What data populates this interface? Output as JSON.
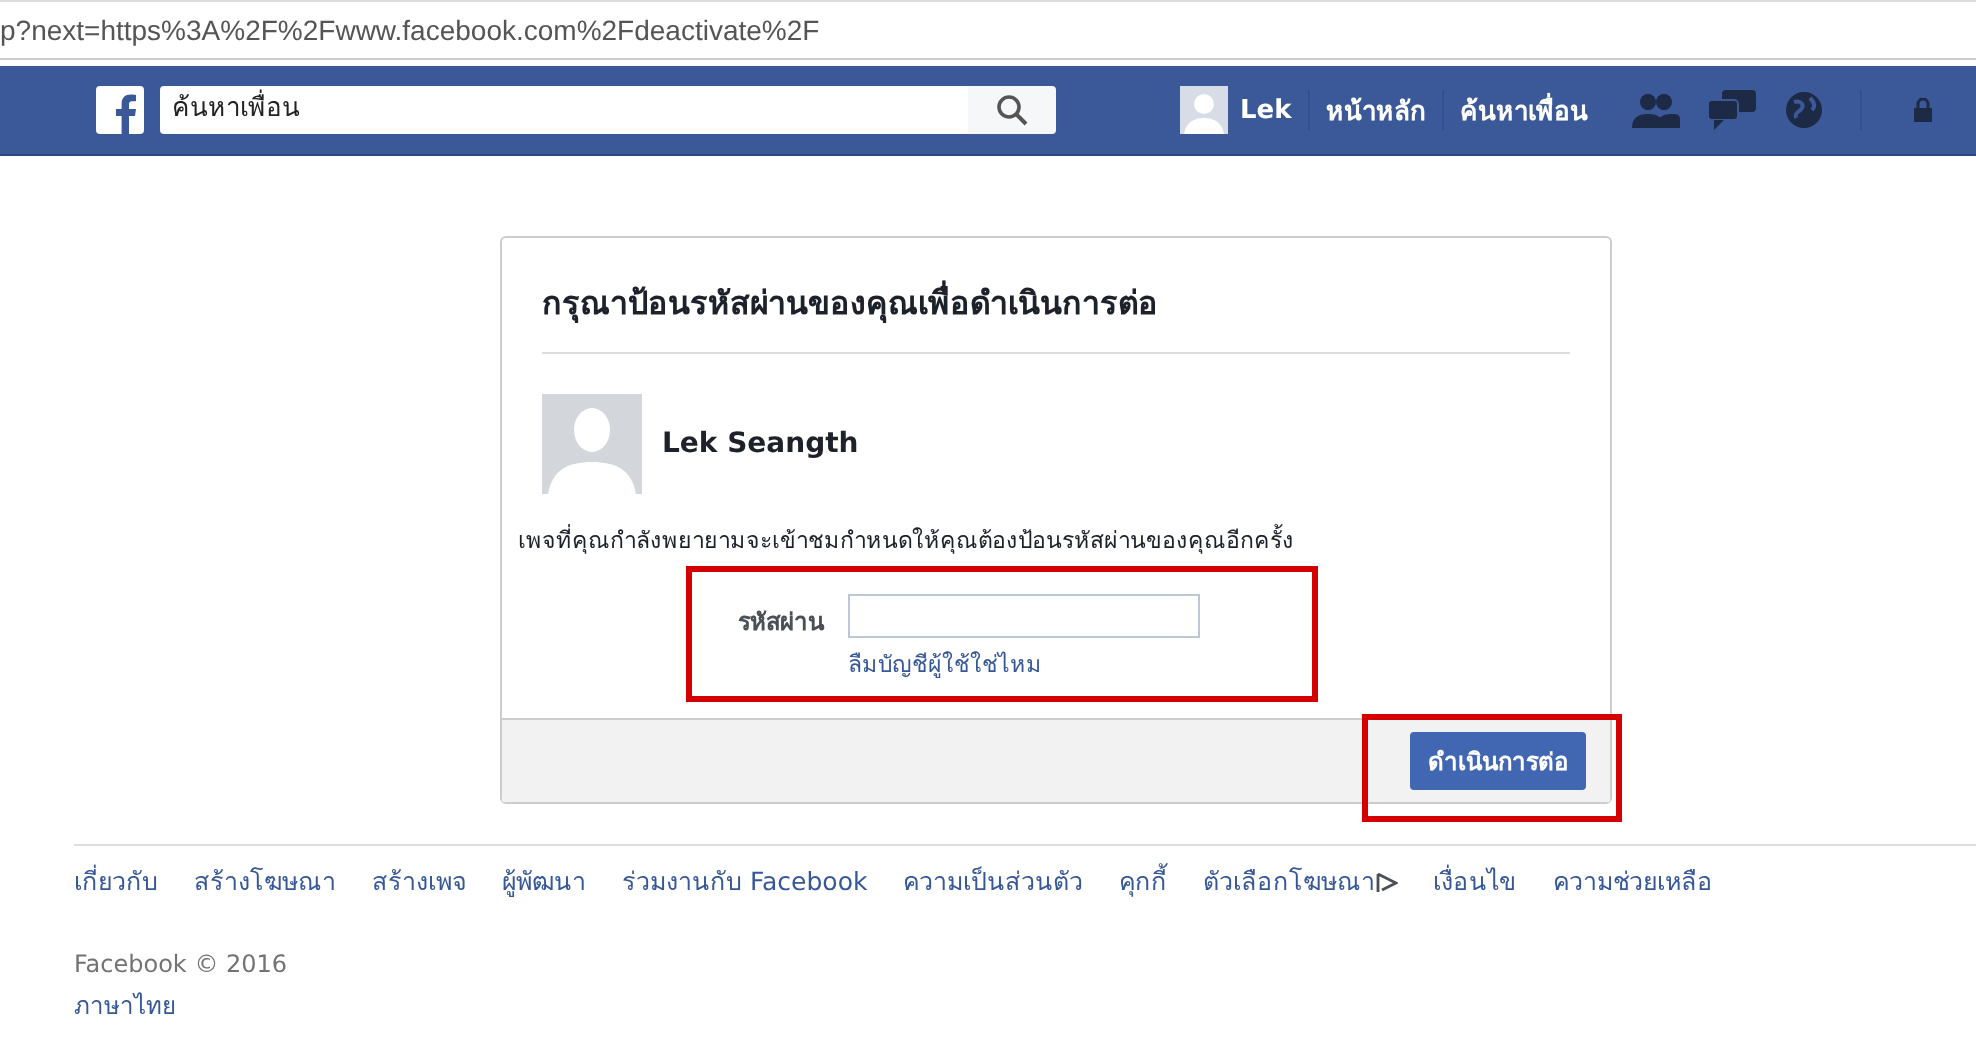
{
  "address_bar": {
    "url": "p?next=https%3A%2F%2Fwww.facebook.com%2Fdeactivate%2F"
  },
  "navbar": {
    "search": {
      "placeholder": "ค้นหาเพื่อน"
    },
    "profile_name": "Lek",
    "links": [
      "หน้าหลัก",
      "ค้นหาเพื่อน"
    ]
  },
  "dialog": {
    "title": "กรุณาป้อนรหัสผ่านของคุณเพื่อดำเนินการต่อ",
    "user_name": "Lek Seangth",
    "message": "เพจที่คุณกำลังพยายามจะเข้าชมกำหนดให้คุณต้องป้อนรหัสผ่านของคุณอีกครั้ง",
    "password_label": "รหัสผ่าน",
    "forgot_link": "ลืมบัญชีผู้ใช้ใช่ไหม",
    "continue_button": "ดำเนินการต่อ"
  },
  "footer": {
    "links": [
      {
        "label": "เกี่ยวกับ"
      },
      {
        "label": "สร้างโฆษณา"
      },
      {
        "label": "สร้างเพจ"
      },
      {
        "label": "ผู้พัฒนา"
      },
      {
        "label": "ร่วมงานกับ Facebook"
      },
      {
        "label": "ความเป็นส่วนตัว"
      },
      {
        "label": "คุกกี้"
      },
      {
        "label": "ตัวเลือกโฆษณา",
        "kind": "adchoices"
      },
      {
        "label": "เงื่อนไข"
      },
      {
        "label": "ความช่วยเหลือ"
      }
    ],
    "copyright": "Facebook © 2016",
    "language": "ภาษาไทย"
  }
}
